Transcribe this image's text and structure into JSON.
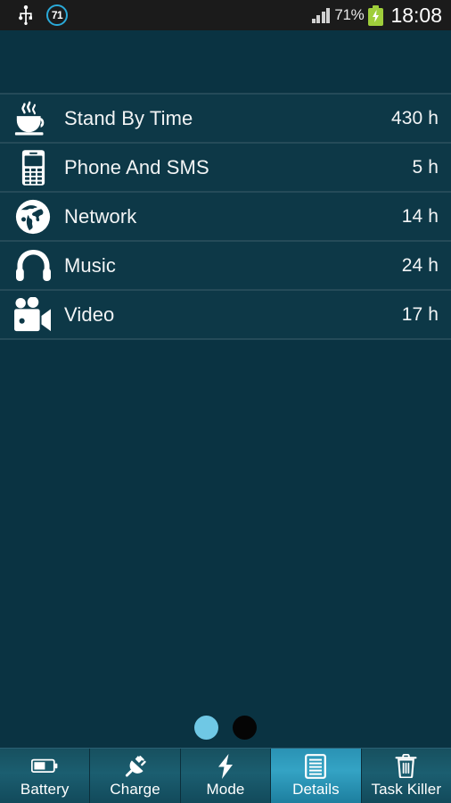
{
  "status_bar": {
    "usb_icon": "usb-icon",
    "notification_count": "71",
    "signal_icon": "signal-bars-icon",
    "battery_percent": "71%",
    "battery_icon": "battery-charging-icon",
    "time": "18:08"
  },
  "colors": {
    "background": "#0a3342",
    "row_background": "#0d3847",
    "separator": "#3d6e7e",
    "accent": "#34a3c4",
    "status_bar": "#1b1b1b",
    "battery_green": "#9fce3b",
    "badge_blue": "#2aa9d8",
    "dot_active": "#6fc8e5",
    "dot_inactive": "#050505"
  },
  "list": {
    "rows": [
      {
        "icon": "coffee-cup-icon",
        "label": "Stand By Time",
        "value": "430 h"
      },
      {
        "icon": "mobile-phone-icon",
        "label": "Phone And SMS",
        "value": "5 h"
      },
      {
        "icon": "globe-icon",
        "label": "Network",
        "value": "14 h"
      },
      {
        "icon": "headphones-icon",
        "label": "Music",
        "value": "24 h"
      },
      {
        "icon": "video-camera-icon",
        "label": "Video",
        "value": "17 h"
      }
    ]
  },
  "pagination": {
    "dots": [
      {
        "state": "active"
      },
      {
        "state": "inactive"
      }
    ]
  },
  "tab_bar": {
    "tabs": [
      {
        "icon": "battery-icon",
        "label": "Battery",
        "active": false
      },
      {
        "icon": "plug-icon",
        "label": "Charge",
        "active": false
      },
      {
        "icon": "bolt-icon",
        "label": "Mode",
        "active": false
      },
      {
        "icon": "document-icon",
        "label": "Details",
        "active": true
      },
      {
        "icon": "trash-icon",
        "label": "Task Killer",
        "active": false
      }
    ]
  }
}
